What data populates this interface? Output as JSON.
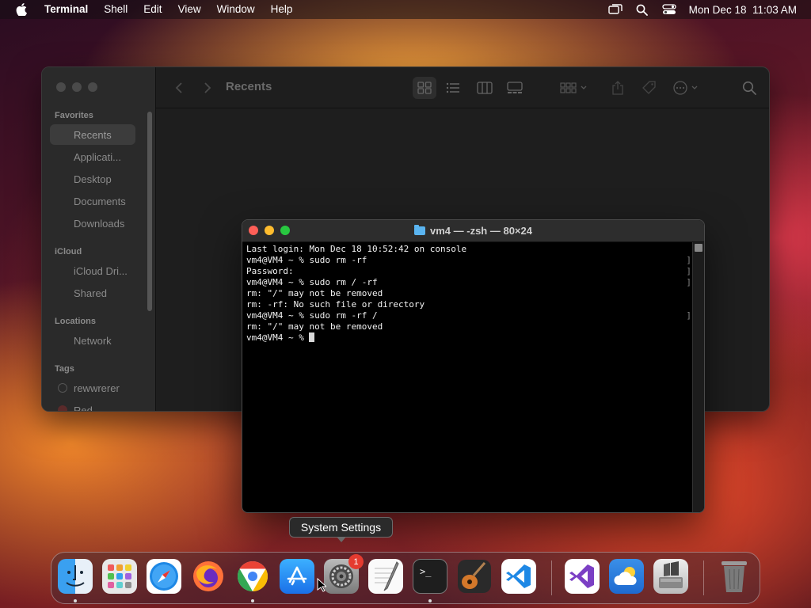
{
  "menubar": {
    "app_name": "Terminal",
    "menus": [
      "Shell",
      "Edit",
      "View",
      "Window",
      "Help"
    ],
    "datetime": "Mon Dec 18  11:03 AM",
    "icons": [
      "apple-icon",
      "screen-mirroring-icon",
      "search-icon",
      "control-center-icon"
    ]
  },
  "finder": {
    "title": "Recents",
    "favorites_header": "Favorites",
    "icloud_header": "iCloud",
    "locations_header": "Locations",
    "tags_header": "Tags",
    "favorites": [
      "Recents",
      "Applicati...",
      "Desktop",
      "Documents",
      "Downloads"
    ],
    "icloud": [
      "iCloud Dri...",
      "Shared"
    ],
    "locations": [
      "Network"
    ],
    "tags": [
      "rewwrerer",
      "Red"
    ]
  },
  "terminal": {
    "title": "vm4 — -zsh — 80×24",
    "lines": [
      "Last login: Mon Dec 18 10:52:42 on console",
      "vm4@VM4 ~ % sudo rm -rf",
      "Password:",
      "vm4@VM4 ~ % sudo rm / -rf",
      "rm: \"/\" may not be removed",
      "rm: -rf: No such file or directory",
      "vm4@VM4 ~ % sudo rm -rf /",
      "rm: \"/\" may not be removed",
      "vm4@VM4 ~ % "
    ]
  },
  "tooltip": "System Settings",
  "dock": {
    "badge_count": "1",
    "apps": [
      "Finder",
      "Launchpad",
      "Safari",
      "Firefox",
      "Chrome",
      "App Store",
      "System Settings",
      "TextEdit",
      "Terminal",
      "GarageBand",
      "Visual Studio Code",
      "Visual Studio",
      "Weather",
      "Boot Camp Assistant",
      "Trash"
    ]
  },
  "colors": {
    "traffic_red": "#ff5f57",
    "traffic_yellow": "#febc2e",
    "traffic_green": "#28c840",
    "badge_red": "#e53b30",
    "folder_blue": "#5ab4f0"
  }
}
